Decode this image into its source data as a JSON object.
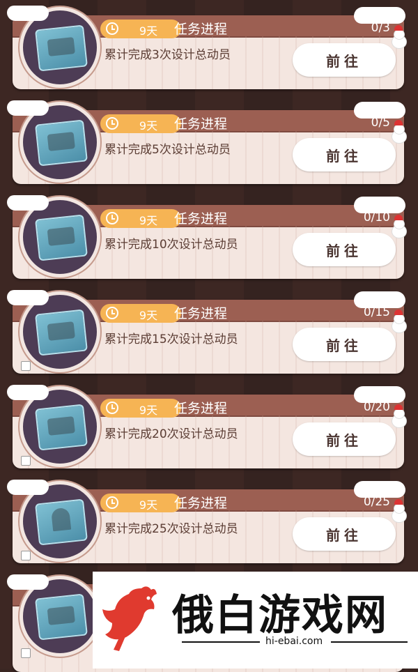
{
  "tasks": [
    {
      "days": "9天",
      "header": "任务进程",
      "count": "0/3",
      "desc": "累计完成3次设计总动员",
      "button": "前往",
      "checkbox": false
    },
    {
      "days": "9天",
      "header": "任务进程",
      "count": "0/5",
      "desc": "累计完成5次设计总动员",
      "button": "前往",
      "checkbox": false
    },
    {
      "days": "9天",
      "header": "任务进程",
      "count": "0/10",
      "desc": "累计完成10次设计总动员",
      "button": "前往",
      "checkbox": false
    },
    {
      "days": "9天",
      "header": "任务进程",
      "count": "0/15",
      "desc": "累计完成15次设计总动员",
      "button": "前往",
      "checkbox": true
    },
    {
      "days": "9天",
      "header": "任务进程",
      "count": "0/20",
      "desc": "累计完成20次设计总动员",
      "button": "前往",
      "checkbox": true
    },
    {
      "days": "9天",
      "header": "任务进程",
      "count": "0/25",
      "desc": "累计完成25次设计总动员",
      "button": "前往",
      "checkbox": true
    }
  ],
  "watermark": {
    "name": "俄白游戏网",
    "url": "hi-ebai.com"
  },
  "colors": {
    "header": "#9c5f52",
    "pill": "#f6b454",
    "card": "#f4e6e0"
  }
}
